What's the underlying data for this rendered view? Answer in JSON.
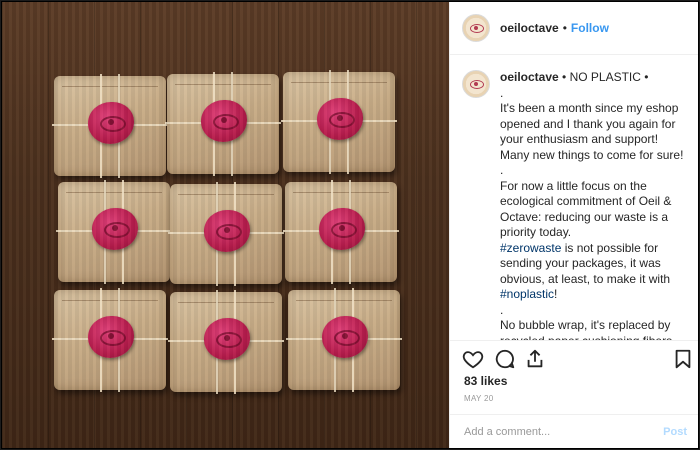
{
  "post": {
    "username": "oeiloctave",
    "follow_label": "Follow",
    "header_dot": "•"
  },
  "caption": {
    "username": "oeiloctave",
    "title_text": "• NO PLASTIC •",
    "lines": [
      ".",
      "It's been a month since my eshop opened and I thank you again for your enthusiasm and support! Many new things to come for sure!",
      ".",
      "For now a little focus on the ecological commitment of Oeil & Octave: reducing our waste is a priority today."
    ],
    "para3_before": "",
    "hashtag1": "#zerowaste",
    "para3_mid": " is not possible for sending your packages, it was obvious, at least, to make it with ",
    "hashtag2": "#noplastic",
    "para3_end": "!",
    "sep": ".",
    "para4": "No bubble wrap, it's replaced by recycled paper cushioning fibers guaranteeing protection of your orders. Boxes are 70% recycled and 100% recyclable as well as its adhesive tape with no plastic material. Candles"
  },
  "stats": {
    "likes": "83 likes",
    "date": "MAY 20"
  },
  "comment_box": {
    "placeholder": "Add a comment...",
    "post_label": "Post"
  },
  "icons": {
    "like": "heart-icon",
    "comment": "comment-icon",
    "share": "share-icon",
    "save": "bookmark-icon"
  },
  "colors": {
    "link": "#3897f0",
    "hashtag": "#003569",
    "seal": "#b71c4d"
  }
}
